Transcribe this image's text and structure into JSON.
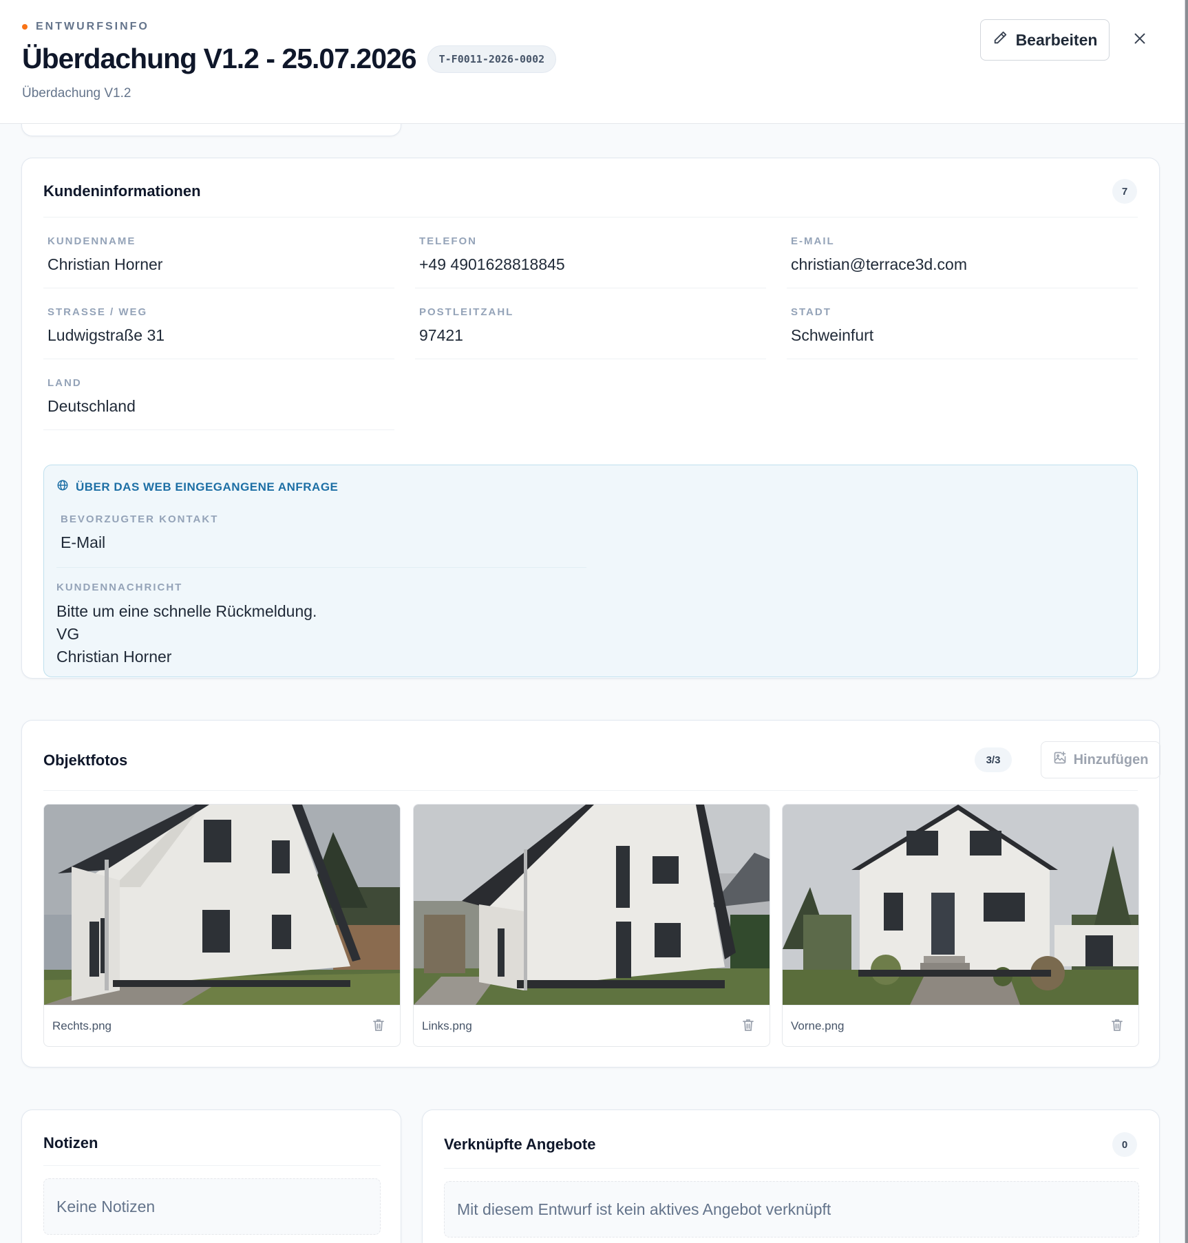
{
  "header": {
    "eyebrow": "ENTWURFSINFO",
    "title": "Überdachung V1.2 - 25.07.2026",
    "code": "T-F0011-2026-0002",
    "subtitle": "Überdachung V1.2",
    "edit_label": "Bearbeiten",
    "accent_color": "#f97316"
  },
  "customer": {
    "title": "Kundeninformationen",
    "count": "7",
    "fields": [
      {
        "label": "KUNDENNAME",
        "value": "Christian Horner"
      },
      {
        "label": "TELEFON",
        "value": "+49 4901628818845"
      },
      {
        "label": "E-MAIL",
        "value": "christian@terrace3d.com"
      },
      {
        "label": "STRASSE / WEG",
        "value": "Ludwigstraße 31"
      },
      {
        "label": "POSTLEITZAHL",
        "value": "97421"
      },
      {
        "label": "STADT",
        "value": "Schweinfurt"
      },
      {
        "label": "LAND",
        "value": "Deutschland"
      }
    ],
    "web": {
      "heading": "ÜBER DAS WEB EINGEGANGENE ANFRAGE",
      "contact_label": "BEVORZUGTER KONTAKT",
      "contact_value": "E-Mail",
      "message_label": "KUNDENNACHRICHT",
      "message_lines": [
        "Bitte um eine schnelle Rückmeldung.",
        "VG",
        "Christian Horner"
      ]
    }
  },
  "photos": {
    "title": "Objektfotos",
    "count": "3/3",
    "add_label": "Hinzufügen",
    "items": [
      {
        "name": "Rechts.png"
      },
      {
        "name": "Links.png"
      },
      {
        "name": "Vorne.png"
      }
    ]
  },
  "notes": {
    "title": "Notizen",
    "empty": "Keine Notizen"
  },
  "offers": {
    "title": "Verknüpfte Angebote",
    "count": "0",
    "empty": "Mit diesem Entwurf ist kein aktives Angebot verknüpft"
  },
  "icons": {
    "edit": "pencil-icon",
    "close": "close-icon",
    "web": "globe-icon",
    "add_photo": "image-plus-icon",
    "delete": "trash-icon"
  }
}
